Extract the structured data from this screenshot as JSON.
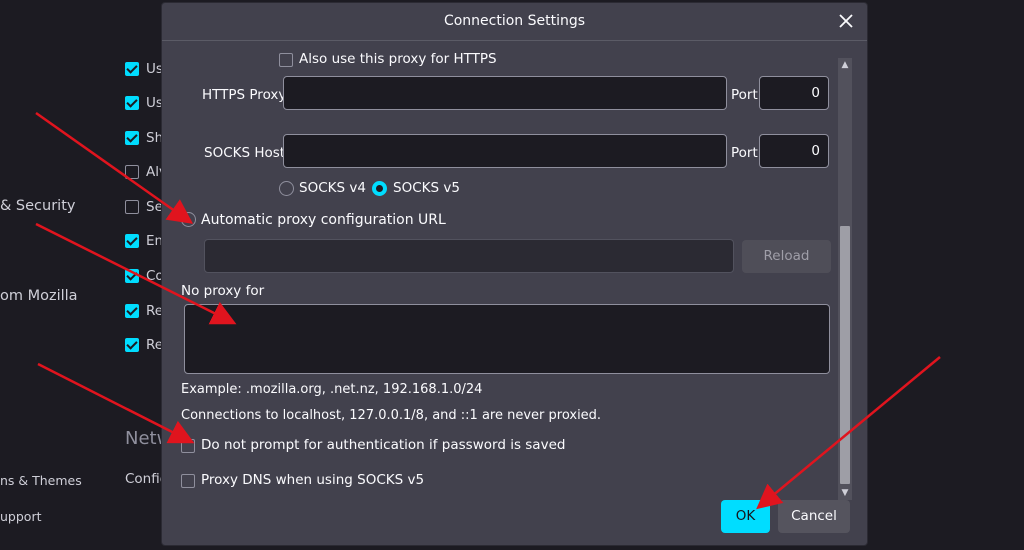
{
  "background": {
    "sidebar": {
      "privacy_partial": "& Security",
      "mozilla_partial": "om Mozilla",
      "themes_partial": "ns & Themes",
      "support_partial": "upport"
    },
    "main": {
      "network_partial": "Netw",
      "config_partial": "Config",
      "checkbox_labels": [
        "Us",
        "Us",
        "Sh",
        "Alv",
        "Se",
        "En",
        "Co",
        "Re",
        "Re"
      ],
      "checkbox_states": [
        true,
        true,
        true,
        false,
        false,
        true,
        true,
        true,
        true
      ]
    }
  },
  "dialog": {
    "title": "Connection Settings",
    "also_https_label": "Also use this proxy for HTTPS",
    "https_proxy": {
      "label": "HTTPS Proxy",
      "value": "",
      "port_label": "Port",
      "port_value": "0"
    },
    "socks_host": {
      "label": "SOCKS Host",
      "value": "",
      "port_label": "Port",
      "port_value": "0"
    },
    "socks_v4_label": "SOCKS v4",
    "socks_v5_label": "SOCKS v5",
    "socks_selected": "v5",
    "auto_proxy_label": "Automatic proxy configuration URL",
    "auto_proxy_url": "",
    "reload_label": "Reload",
    "no_proxy_label": "No proxy for",
    "no_proxy_value": "",
    "example_text": "Example: .mozilla.org, .net.nz, 192.168.1.0/24",
    "localhost_note": "Connections to localhost, 127.0.0.1/8, and ::1 are never proxied.",
    "no_auth_prompt_label": "Do not prompt for authentication if password is saved",
    "proxy_dns_label": "Proxy DNS when using SOCKS v5",
    "ok_label": "OK",
    "cancel_label": "Cancel"
  },
  "colors": {
    "accent": "#00ddff",
    "annotation_arrow": "#e0141e",
    "dialog_bg": "#42414d",
    "page_bg": "#1c1b22"
  }
}
